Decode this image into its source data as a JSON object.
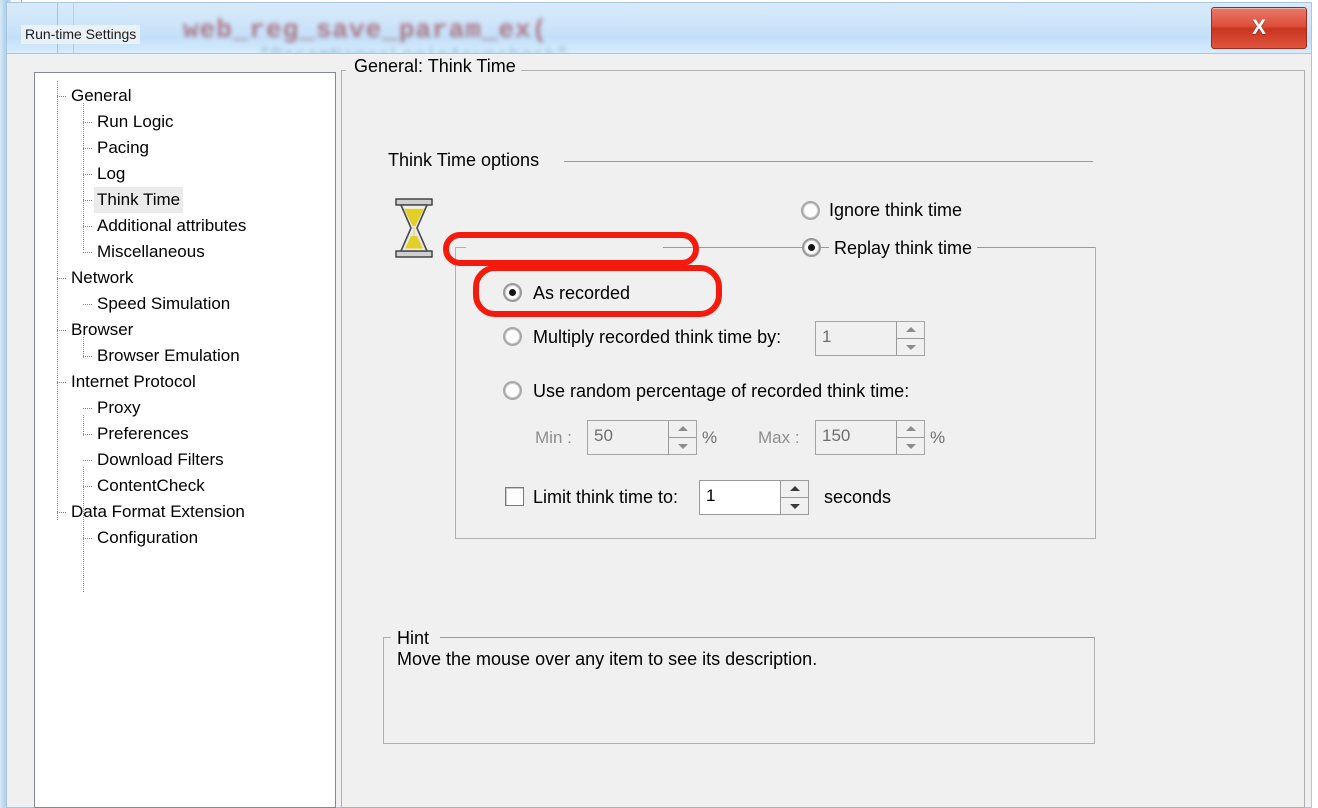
{
  "window": {
    "title": "Run-time Settings",
    "close_label": "X",
    "close_icon": "close-icon",
    "ghost_code_line1": "web_reg_save_param_ex(",
    "ghost_code_line2": "\"ParamName=LoginAsyncheck\","
  },
  "sidebar": {
    "items": [
      {
        "label": "General",
        "level": 0,
        "selected": false
      },
      {
        "label": "Run Logic",
        "level": 1,
        "selected": false
      },
      {
        "label": "Pacing",
        "level": 1,
        "selected": false
      },
      {
        "label": "Log",
        "level": 1,
        "selected": false
      },
      {
        "label": "Think Time",
        "level": 1,
        "selected": true
      },
      {
        "label": "Additional attributes",
        "level": 1,
        "selected": false
      },
      {
        "label": "Miscellaneous",
        "level": 1,
        "selected": false
      },
      {
        "label": "Network",
        "level": 0,
        "selected": false
      },
      {
        "label": "Speed Simulation",
        "level": 1,
        "selected": false
      },
      {
        "label": "Browser",
        "level": 0,
        "selected": false
      },
      {
        "label": "Browser Emulation",
        "level": 1,
        "selected": false
      },
      {
        "label": "Internet Protocol",
        "level": 0,
        "selected": false
      },
      {
        "label": "Proxy",
        "level": 1,
        "selected": false
      },
      {
        "label": "Preferences",
        "level": 1,
        "selected": false
      },
      {
        "label": "Download Filters",
        "level": 1,
        "selected": false
      },
      {
        "label": "ContentCheck",
        "level": 1,
        "selected": false
      },
      {
        "label": "Data Format Extension",
        "level": 0,
        "selected": false
      },
      {
        "label": "Configuration",
        "level": 1,
        "selected": false
      }
    ]
  },
  "main": {
    "page_title": "General: Think Time",
    "section_title": "Think Time options",
    "hourglass_icon": "hourglass-icon",
    "ignore_think_time": {
      "label": "Ignore think time",
      "selected": false
    },
    "replay_think_time": {
      "label": "Replay think time",
      "selected": true
    },
    "as_recorded": {
      "label": "As recorded",
      "selected": true
    },
    "multiply": {
      "label": "Multiply recorded think time by:",
      "selected": false,
      "value": "1",
      "enabled": false
    },
    "random_percentage": {
      "label": "Use random percentage of recorded think time:",
      "selected": false,
      "min_label": "Min :",
      "min_value": "50",
      "min_unit": "%",
      "max_label": "Max :",
      "max_value": "150",
      "max_unit": "%",
      "enabled": false
    },
    "limit": {
      "label": "Limit think time to:",
      "checked": false,
      "value": "1",
      "unit": "seconds",
      "enabled": true
    },
    "hint": {
      "title": "Hint",
      "text": "Move the mouse over any item to see its description."
    }
  },
  "annotations": {
    "color": "#f51b0c",
    "highlight_1": "replay-think-time-row",
    "highlight_2": "as-recorded-row"
  }
}
